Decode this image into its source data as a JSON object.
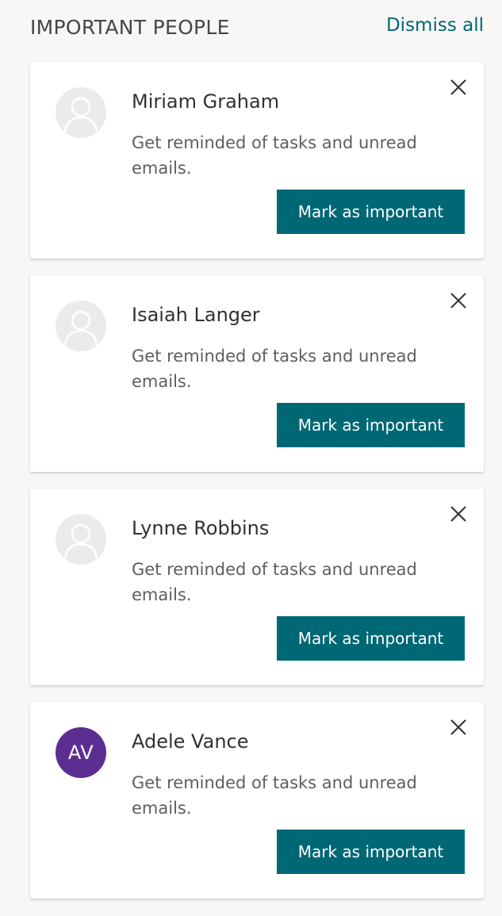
{
  "header": {
    "title": "IMPORTANT PEOPLE",
    "dismiss_all_label": "Dismiss all"
  },
  "cards": [
    {
      "name": "Miriam Graham",
      "description": "Get reminded of tasks and unread emails.",
      "button_label": "Mark as important",
      "avatar": "person-placeholder-icon"
    },
    {
      "name": "Isaiah Langer",
      "description": "Get reminded of tasks and unread emails.",
      "button_label": "Mark as important",
      "avatar": "person-placeholder-icon"
    },
    {
      "name": "Lynne Robbins",
      "description": "Get reminded of tasks and unread emails.",
      "button_label": "Mark as important",
      "avatar": "person-placeholder-icon"
    },
    {
      "name": "Adele Vance",
      "description": "Get reminded of tasks and unread emails.",
      "button_label": "Mark as important",
      "avatar_initials": "AV",
      "avatar_color": "#5c2e91"
    }
  ],
  "colors": {
    "accent": "#006775",
    "background": "#f8f7f6"
  }
}
